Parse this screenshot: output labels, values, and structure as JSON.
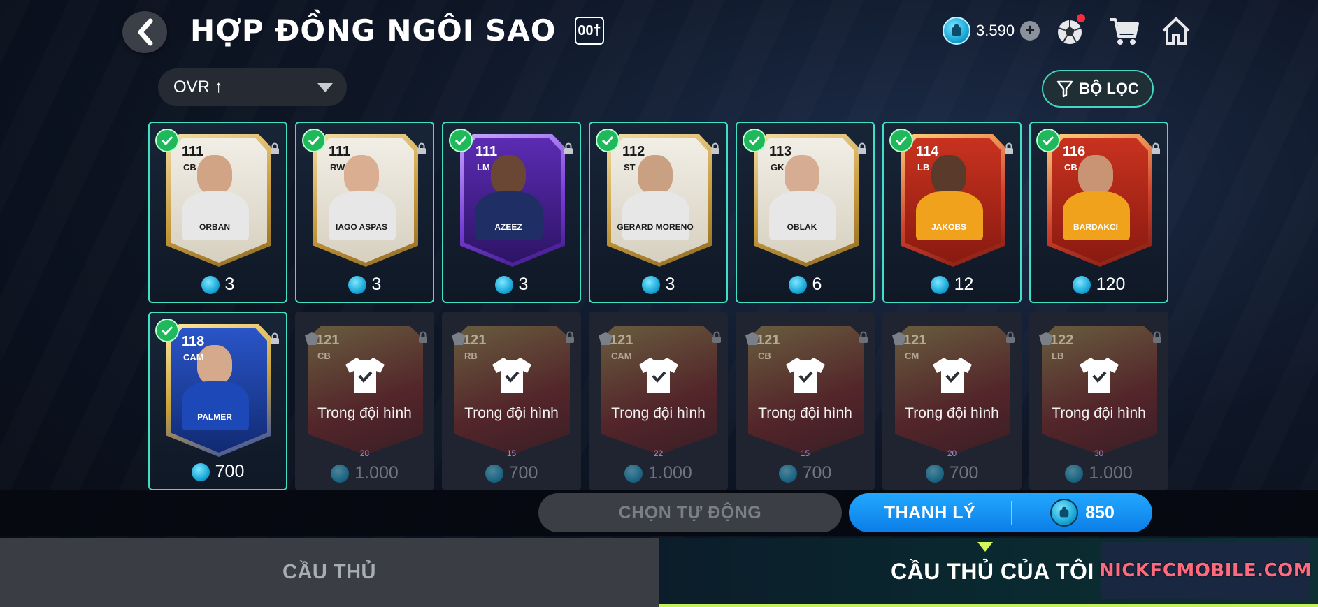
{
  "header": {
    "title": "HỢP ĐỒNG NGÔI SAO",
    "badge": "00†",
    "currency_amount": "3.590"
  },
  "sort": {
    "label": "OVR ↑"
  },
  "filter": {
    "label": "BỘ LỌC"
  },
  "selected_cards": [
    {
      "ovr": "111",
      "pos": "CB",
      "name": "ORBAN",
      "price": "3",
      "theme": "gold"
    },
    {
      "ovr": "111",
      "pos": "RW",
      "name": "IAGO ASPAS",
      "price": "3",
      "theme": "gold"
    },
    {
      "ovr": "111",
      "pos": "LM",
      "name": "AZEEZ",
      "price": "3",
      "theme": "purple"
    },
    {
      "ovr": "112",
      "pos": "ST",
      "name": "GERARD MORENO",
      "price": "3",
      "theme": "gold"
    },
    {
      "ovr": "113",
      "pos": "GK",
      "name": "OBLAK",
      "price": "6",
      "theme": "gold"
    },
    {
      "ovr": "114",
      "pos": "LB",
      "name": "JAKOBS",
      "price": "12",
      "theme": "red"
    },
    {
      "ovr": "116",
      "pos": "CB",
      "name": "BARDAKCI",
      "price": "120",
      "theme": "red"
    },
    {
      "ovr": "118",
      "pos": "CAM",
      "name": "PALMER",
      "price": "700",
      "theme": "blue"
    }
  ],
  "squad_cards": [
    {
      "ovr": "121",
      "pos": "CB",
      "level": "28",
      "label": "Trong đội hình",
      "price": "1.000"
    },
    {
      "ovr": "121",
      "pos": "RB",
      "level": "15",
      "label": "Trong đội hình",
      "price": "700"
    },
    {
      "ovr": "121",
      "pos": "CAM",
      "level": "22",
      "label": "Trong đội hình",
      "price": "1.000"
    },
    {
      "ovr": "121",
      "pos": "CB",
      "level": "15",
      "label": "Trong đội hình",
      "price": "700"
    },
    {
      "ovr": "121",
      "pos": "CM",
      "level": "20",
      "label": "Trong đội hình",
      "price": "700"
    },
    {
      "ovr": "122",
      "pos": "LB",
      "level": "30",
      "label": "Trong đội hình",
      "price": "1.000"
    }
  ],
  "actions": {
    "auto_select": "CHỌN TỰ ĐỘNG",
    "sell": "THANH LÝ",
    "sell_total": "850"
  },
  "tabs": {
    "players": "CẦU THỦ",
    "my_players": "CẦU THỦ CỦA TÔI"
  },
  "watermark": "NICKFCMOBILE.COM",
  "colors": {
    "accent_teal": "#3fe0c3",
    "sell_blue": "#1493f5",
    "check_green": "#1fb85a",
    "tab_highlight": "#c4f05a"
  }
}
